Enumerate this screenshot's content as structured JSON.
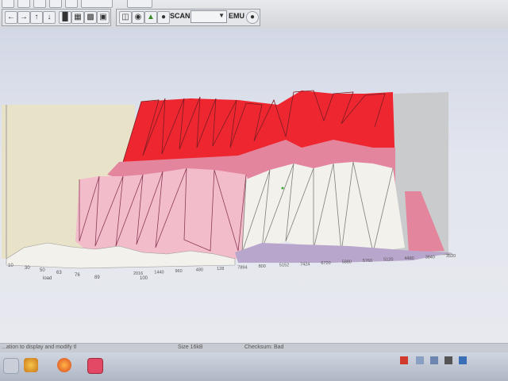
{
  "toolbar": {
    "scan_label": "SCAN",
    "emu_label": "EMU",
    "scan_value": ""
  },
  "statusbar": {
    "left_text": "...ation to display and modify tl",
    "size_text": "Size 16kB",
    "checksum_text": "Checksum: Bad"
  },
  "chart_data": {
    "type": "surface3d",
    "x_tick_labels": [
      "10",
      "30",
      "50",
      "63",
      "76",
      "89"
    ],
    "x_axis_label": "load",
    "z_tick_labels": [
      "2016",
      "1440",
      "960",
      "480",
      "128",
      "7894",
      "800",
      "5152",
      "7424",
      "6720",
      "5880",
      "5760",
      "5120",
      "4480",
      "3840",
      "3520"
    ],
    "z_extra_label": "100",
    "colors": {
      "peak_red": "#ee2630",
      "mid_pink": "#e4859e",
      "low_pink": "#f2bccb",
      "base_white": "#f3f1ec",
      "base_lilac": "#b9a6cc",
      "back_wall_left": "#e8e2c9",
      "back_wall_right": "#c9cbcc"
    }
  }
}
